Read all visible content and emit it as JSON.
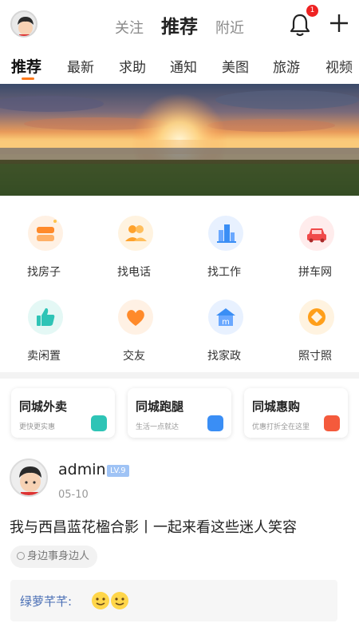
{
  "header": {
    "tabs": [
      {
        "label": "关注"
      },
      {
        "label": "推荐"
      },
      {
        "label": "附近"
      }
    ],
    "notification_count": "1",
    "icons": [
      "avatar",
      "bell-icon",
      "plus-icon"
    ]
  },
  "categories": [
    "推荐",
    "最新",
    "求助",
    "通知",
    "美图",
    "旅游",
    "视频"
  ],
  "services": [
    {
      "label": "找房子",
      "icon": "house-icon",
      "color": "#ff8a2a"
    },
    {
      "label": "找电话",
      "icon": "contacts-icon",
      "color": "#ffa22b"
    },
    {
      "label": "找工作",
      "icon": "buildings-icon",
      "color": "#3a8ef5"
    },
    {
      "label": "拼车网",
      "icon": "car-icon",
      "color": "#f04a4a"
    },
    {
      "label": "卖闲置",
      "icon": "thumbs-up-icon",
      "color": "#2ec4b6"
    },
    {
      "label": "交友",
      "icon": "heart-icon",
      "color": "#ff8a2a"
    },
    {
      "label": "找家政",
      "icon": "home-service-icon",
      "color": "#3a8ef5"
    },
    {
      "label": "照寸照",
      "icon": "photo-icon",
      "color": "#ff9f1a"
    }
  ],
  "cards": [
    {
      "title": "同城外卖",
      "subtitle": "更快更实惠",
      "icon": "delivery-icon",
      "color": "#2ec4b6"
    },
    {
      "title": "同城跑腿",
      "subtitle": "生活一点就达",
      "icon": "location-icon",
      "color": "#3a8ef5"
    },
    {
      "title": "同城惠购",
      "subtitle": "优惠打折全在这里",
      "icon": "shop-icon",
      "color": "#f45a3c"
    }
  ],
  "post": {
    "username": "admin",
    "level": "LV.9",
    "date": "05-10",
    "title": "我与西昌蓝花楹合影丨一起来看这些迷人笑容",
    "tag": "身边事身边人",
    "comment_name": "绿萝芊芊:"
  }
}
